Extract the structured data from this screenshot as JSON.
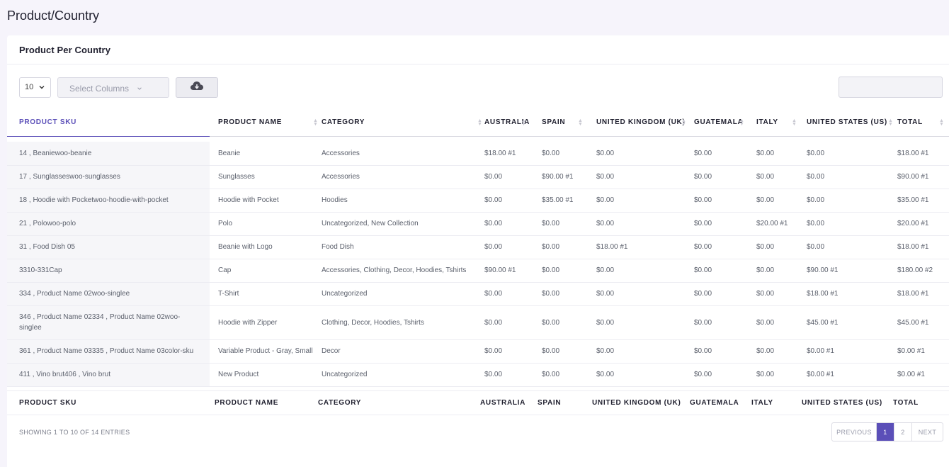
{
  "page_title": "Product/Country",
  "card_title": "Product Per Country",
  "toolbar": {
    "page_length": "10",
    "select_columns_placeholder": "Select Columns",
    "search_value": ""
  },
  "columns": [
    "PRODUCT SKU",
    "PRODUCT NAME",
    "CATEGORY",
    "AUSTRALIA",
    "SPAIN",
    "UNITED KINGDOM (UK)",
    "GUATEMALA",
    "ITALY",
    "UNITED STATES (US)",
    "TOTAL"
  ],
  "rows": [
    [
      "14 , Beaniewoo-beanie",
      "Beanie",
      "Accessories",
      "$18.00 #1",
      "$0.00",
      "$0.00",
      "$0.00",
      "$0.00",
      "$0.00",
      "$18.00 #1"
    ],
    [
      "17 , Sunglasseswoo-sunglasses",
      "Sunglasses",
      "Accessories",
      "$0.00",
      "$90.00 #1",
      "$0.00",
      "$0.00",
      "$0.00",
      "$0.00",
      "$90.00 #1"
    ],
    [
      "18 , Hoodie with Pocketwoo-hoodie-with-pocket",
      "Hoodie with Pocket",
      "Hoodies",
      "$0.00",
      "$35.00 #1",
      "$0.00",
      "$0.00",
      "$0.00",
      "$0.00",
      "$35.00 #1"
    ],
    [
      "21 , Polowoo-polo",
      "Polo",
      "Uncategorized, New Collection",
      "$0.00",
      "$0.00",
      "$0.00",
      "$0.00",
      "$20.00 #1",
      "$0.00",
      "$20.00 #1"
    ],
    [
      "31 , Food Dish 05",
      "Beanie with Logo",
      "Food Dish",
      "$0.00",
      "$0.00",
      "$18.00 #1",
      "$0.00",
      "$0.00",
      "$0.00",
      "$18.00 #1"
    ],
    [
      "3310-331Cap",
      "Cap",
      "Accessories, Clothing, Decor, Hoodies, Tshirts",
      "$90.00 #1",
      "$0.00",
      "$0.00",
      "$0.00",
      "$0.00",
      "$90.00 #1",
      "$180.00 #2"
    ],
    [
      "334 , Product Name 02woo-singlee",
      "T-Shirt",
      "Uncategorized",
      "$0.00",
      "$0.00",
      "$0.00",
      "$0.00",
      "$0.00",
      "$18.00 #1",
      "$18.00 #1"
    ],
    [
      "346 , Product Name 02334 , Product Name 02woo-singlee",
      "Hoodie with Zipper",
      "Clothing, Decor, Hoodies, Tshirts",
      "$0.00",
      "$0.00",
      "$0.00",
      "$0.00",
      "$0.00",
      "$45.00 #1",
      "$45.00 #1"
    ],
    [
      "361 , Product Name 03335 , Product Name 03color-sku",
      "Variable Product - Gray, Small",
      "Decor",
      "$0.00",
      "$0.00",
      "$0.00",
      "$0.00",
      "$0.00",
      "$0.00 #1",
      "$0.00 #1"
    ],
    [
      "411 , Vino brut406 , Vino brut",
      "New Product",
      "Uncategorized",
      "$0.00",
      "$0.00",
      "$0.00",
      "$0.00",
      "$0.00",
      "$0.00 #1",
      "$0.00 #1"
    ]
  ],
  "footer_info": "SHOWING 1 TO 10 OF 14 ENTRIES",
  "pagination": {
    "prev": "PREVIOUS",
    "pages": [
      "1",
      "2"
    ],
    "active_page": "1",
    "next": "NEXT"
  },
  "icons": {
    "export": "cloud-download-icon",
    "sort": "sort-arrows-icon",
    "dropdown": "chevron-down-icon"
  },
  "colors": {
    "accent": "#5b4fb8",
    "background": "#f6f4fb",
    "sku_cell_bg": "#f6f6f9"
  }
}
